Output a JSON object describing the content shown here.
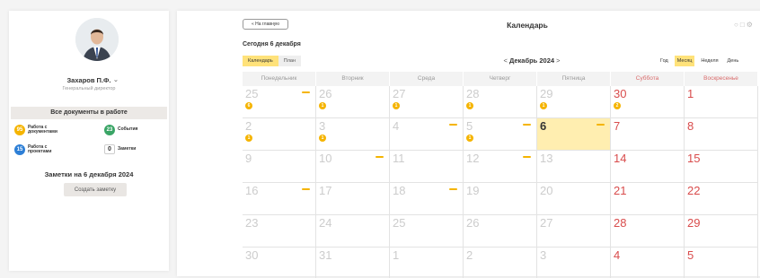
{
  "user": {
    "name": "Захаров П.Ф.",
    "role": "Генеральный директор"
  },
  "sidebar": {
    "docs_header": "Все документы в работе",
    "stats": [
      {
        "count": "95",
        "label_line1": "Работа с",
        "label_line2": "документами",
        "color": "#f5b400"
      },
      {
        "count": "23",
        "label_line1": "События",
        "label_line2": "",
        "color": "#3aa566"
      },
      {
        "count": "15",
        "label_line1": "Работа с",
        "label_line2": "проектами",
        "color": "#2d7fd6"
      },
      {
        "count": "0",
        "label_line1": "Заметки",
        "label_line2": "",
        "color": "#ffffff"
      }
    ],
    "notes_title": "Заметки на 6 декабря 2024",
    "create_note_label": "Создать заметку"
  },
  "header": {
    "home_label": "« На главную",
    "title": "Календарь",
    "today_label": "Сегодня 6 декабря",
    "view_tabs": [
      "Календарь",
      "План"
    ],
    "active_view": "Календарь",
    "month_label": "Декабрь 2024",
    "prev_arrow": "<",
    "next_arrow": ">",
    "period_tabs": [
      "Год",
      "Месяц",
      "Неделя",
      "День"
    ],
    "active_period": "Месяц"
  },
  "calendar": {
    "weekdays": [
      "Понедельник",
      "Вторник",
      "Среда",
      "Четверг",
      "Пятница",
      "Суббота",
      "Воскресенье"
    ],
    "weeks": [
      [
        {
          "d": "25",
          "muted": true,
          "ev": true,
          "cnt": "6"
        },
        {
          "d": "26",
          "muted": true,
          "cnt": "1"
        },
        {
          "d": "27",
          "muted": true,
          "cnt": "1"
        },
        {
          "d": "28",
          "muted": true,
          "cnt": "1"
        },
        {
          "d": "29",
          "muted": true,
          "cnt": "1"
        },
        {
          "d": "30",
          "weekend": true,
          "cnt": "2"
        },
        {
          "d": "1",
          "weekend": true
        }
      ],
      [
        {
          "d": "2",
          "muted": true,
          "cnt": "1"
        },
        {
          "d": "3",
          "muted": true,
          "cnt": "1"
        },
        {
          "d": "4",
          "muted": true,
          "ev": true
        },
        {
          "d": "5",
          "muted": true,
          "ev": true,
          "cnt": "1"
        },
        {
          "d": "6",
          "today": true,
          "ev": true
        },
        {
          "d": "7",
          "weekend": true
        },
        {
          "d": "8",
          "weekend": true
        }
      ],
      [
        {
          "d": "9",
          "muted": true
        },
        {
          "d": "10",
          "muted": true,
          "ev": true
        },
        {
          "d": "11",
          "muted": true
        },
        {
          "d": "12",
          "muted": true,
          "ev": true
        },
        {
          "d": "13",
          "muted": true
        },
        {
          "d": "14",
          "weekend": true
        },
        {
          "d": "15",
          "weekend": true
        }
      ],
      [
        {
          "d": "16",
          "muted": true,
          "ev": true
        },
        {
          "d": "17",
          "muted": true
        },
        {
          "d": "18",
          "muted": true,
          "ev": true
        },
        {
          "d": "19",
          "muted": true
        },
        {
          "d": "20",
          "muted": true
        },
        {
          "d": "21",
          "weekend": true
        },
        {
          "d": "22",
          "weekend": true
        }
      ],
      [
        {
          "d": "23",
          "muted": true
        },
        {
          "d": "24",
          "muted": true
        },
        {
          "d": "25",
          "muted": true
        },
        {
          "d": "26",
          "muted": true
        },
        {
          "d": "27",
          "muted": true
        },
        {
          "d": "28",
          "weekend": true
        },
        {
          "d": "29",
          "weekend": true
        }
      ],
      [
        {
          "d": "30",
          "muted": true
        },
        {
          "d": "31",
          "muted": true
        },
        {
          "d": "1",
          "muted": true
        },
        {
          "d": "2",
          "muted": true
        },
        {
          "d": "3",
          "muted": true
        },
        {
          "d": "4",
          "weekend": true
        },
        {
          "d": "5",
          "weekend": true
        }
      ]
    ]
  },
  "colors": {
    "accent": "#ffe27a",
    "event": "#f5b400",
    "weekend": "#d94c4c"
  }
}
